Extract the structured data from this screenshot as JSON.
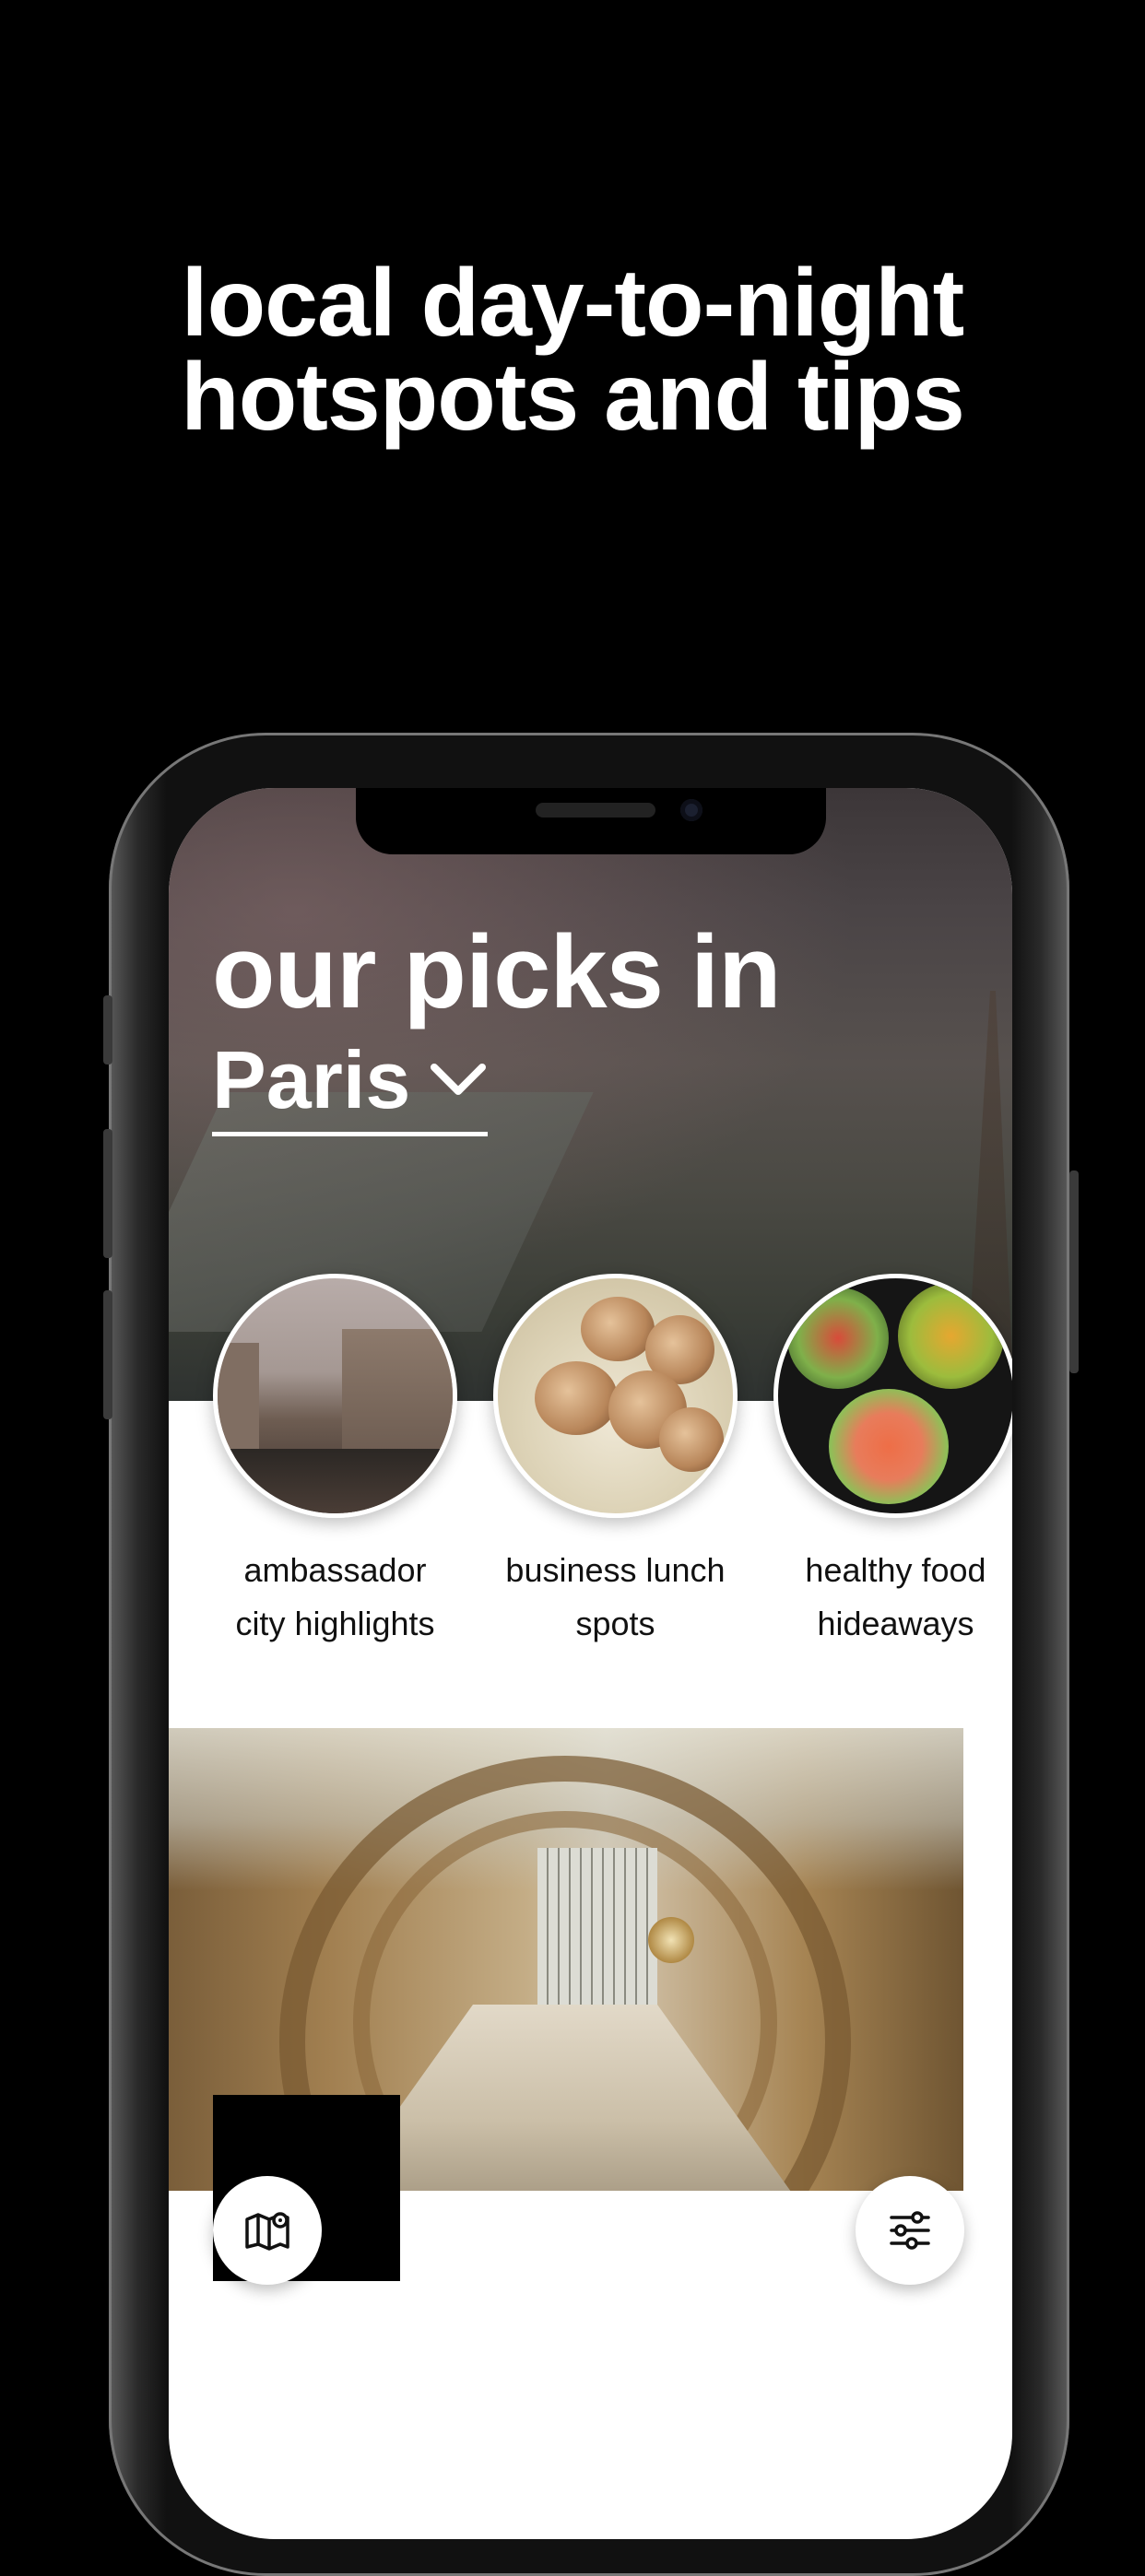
{
  "headline": {
    "line1": "local day-to-night",
    "line2": "hotspots and tips"
  },
  "screen": {
    "title": "our picks in",
    "city": "Paris",
    "categories": [
      {
        "label_line1": "ambassador",
        "label_line2": "city highlights"
      },
      {
        "label_line1": "business lunch",
        "label_line2": "spots"
      },
      {
        "label_line1": "healthy food",
        "label_line2": "hideaways"
      }
    ],
    "icons": {
      "city_dropdown": "chevron-down-icon",
      "map": "map-icon",
      "filter": "filter-icon"
    }
  }
}
